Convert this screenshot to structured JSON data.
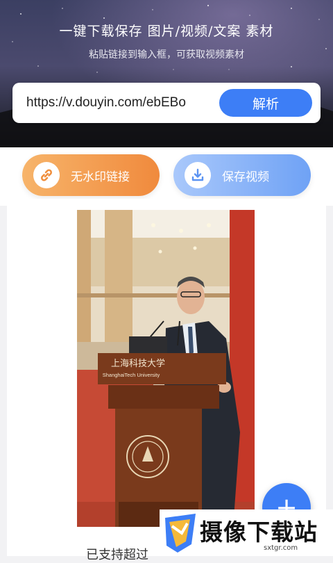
{
  "header": {
    "title": "一键下载保存 图片/视频/文案 素材",
    "subtitle": "粘贴链接到输入框，可获取视频素材"
  },
  "url_input": {
    "value": "https://v.douyin.com/ebEBo"
  },
  "parse_button": {
    "label": "解析"
  },
  "actions": {
    "watermark_free": {
      "label": "无水印链接",
      "icon": "link-icon"
    },
    "save_video": {
      "label": "保存视频",
      "icon": "download-icon"
    }
  },
  "preview": {
    "sign_cn": "上海科技大学",
    "sign_en": "ShanghaiTech University",
    "caption": "已支持超过"
  },
  "fab": {
    "icon": "plus-icon",
    "symbol": "+"
  },
  "watermark": {
    "name": "摄像下载站",
    "domain": "sxtgr.com"
  },
  "colors": {
    "accent": "#3d7ef6",
    "orange": "#f08a3d"
  }
}
